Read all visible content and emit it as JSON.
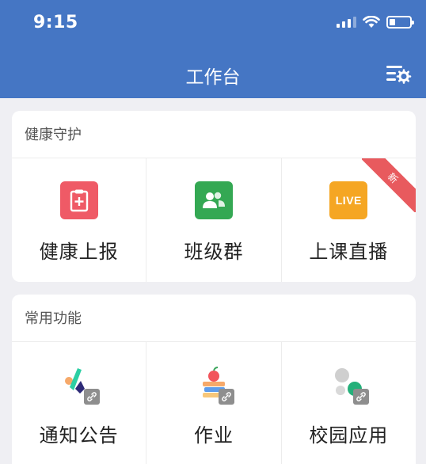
{
  "status_bar": {
    "time": "9:15",
    "signal_bars": 3,
    "battery_level": 0.3
  },
  "nav": {
    "title": "工作台",
    "settings_icon": "list-settings-icon"
  },
  "sections": [
    {
      "title": "健康守护",
      "items": [
        {
          "label": "健康上报",
          "icon": "health-report-icon",
          "color": "#ef5a66"
        },
        {
          "label": "班级群",
          "icon": "class-group-icon",
          "color": "#34a853"
        },
        {
          "label": "上课直播",
          "icon": "live-icon",
          "icon_text": "LIVE",
          "color": "#f5a623",
          "badge": "新",
          "badge_color": "#e85a5e"
        }
      ]
    },
    {
      "title": "常用功能",
      "items": [
        {
          "label": "通知公告",
          "icon": "notice-icon"
        },
        {
          "label": "作业",
          "icon": "homework-icon"
        },
        {
          "label": "校园应用",
          "icon": "campus-apps-icon"
        }
      ]
    }
  ],
  "colors": {
    "header_bg": "#4576c4",
    "page_bg": "#efeff3"
  }
}
